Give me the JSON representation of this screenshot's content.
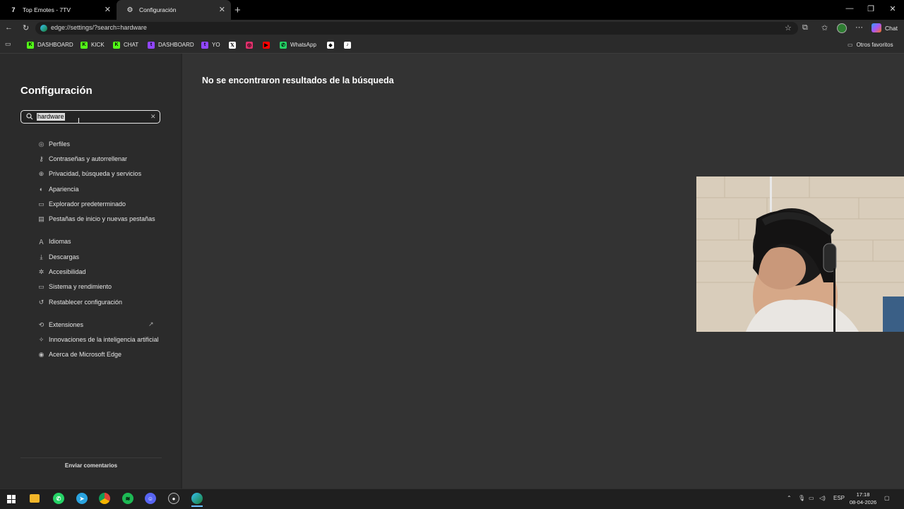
{
  "tabs": [
    {
      "label": "Top Emotes - 7TV",
      "icon": "7tv-logo-icon",
      "active": false
    },
    {
      "label": "Configuración",
      "icon": "gear-icon",
      "active": true
    }
  ],
  "address": {
    "url": "edge://settings/?search=hardware"
  },
  "bookmarks": [
    {
      "label": "DASHBOARD",
      "icon": "kick-icon",
      "color": "#53fc18",
      "glyph": "K"
    },
    {
      "label": "KICK",
      "icon": "kick-icon",
      "color": "#53fc18",
      "glyph": "K"
    },
    {
      "label": "CHAT",
      "icon": "kick-icon",
      "color": "#53fc18",
      "glyph": "K"
    },
    {
      "label": "DASHBOARD",
      "icon": "twitch-icon",
      "color": "#9146ff",
      "glyph": "t"
    },
    {
      "label": "YO",
      "icon": "twitch-icon",
      "color": "#9146ff",
      "glyph": "t"
    },
    {
      "label": "",
      "icon": "x-icon",
      "color": "#ffffff",
      "glyph": "𝕏"
    },
    {
      "label": "",
      "icon": "instagram-icon",
      "color": "#e1306c",
      "glyph": "◎"
    },
    {
      "label": "",
      "icon": "youtube-icon",
      "color": "#ff0000",
      "glyph": "▶"
    },
    {
      "label": "WhatsApp",
      "icon": "whatsapp-icon",
      "color": "#25d366",
      "glyph": "✆"
    },
    {
      "label": "",
      "icon": "diamond-icon",
      "color": "#ffffff",
      "glyph": "◆"
    },
    {
      "label": "",
      "icon": "tiktok-icon",
      "color": "#ffffff",
      "glyph": "♪"
    }
  ],
  "bookmarks_other": "Otros favoritos",
  "chat_label": "Chat",
  "sidebar": {
    "title": "Configuración",
    "search_value": "hardware",
    "items": [
      {
        "label": "Perfiles",
        "icon": "profile-icon"
      },
      {
        "label": "Contraseñas y autorrellenar",
        "icon": "key-icon"
      },
      {
        "label": "Privacidad, búsqueda y servicios",
        "icon": "lock-icon"
      },
      {
        "label": "Apariencia",
        "icon": "palette-icon"
      },
      {
        "label": "Explorador predeterminado",
        "icon": "browser-icon"
      },
      {
        "label": "Pestañas de inicio y nuevas pestañas",
        "icon": "tabs-icon"
      },
      {
        "label": "Idiomas",
        "icon": "language-icon"
      },
      {
        "label": "Descargas",
        "icon": "download-icon"
      },
      {
        "label": "Accesibilidad",
        "icon": "accessibility-icon"
      },
      {
        "label": "Sistema y rendimiento",
        "icon": "laptop-icon"
      },
      {
        "label": "Restablecer configuración",
        "icon": "reset-icon"
      },
      {
        "label": "Extensiones",
        "icon": "puzzle-icon"
      },
      {
        "label": "Innovaciones de la inteligencia artificial",
        "icon": "ai-icon"
      },
      {
        "label": "Acerca de Microsoft Edge",
        "icon": "edge-icon"
      }
    ],
    "feedback": "Enviar comentarios"
  },
  "main": {
    "message": "No se encontraron resultados de la búsqueda"
  },
  "taskbar": {
    "lang": "ESP",
    "time": "17:18",
    "date": "08-04-2026"
  }
}
